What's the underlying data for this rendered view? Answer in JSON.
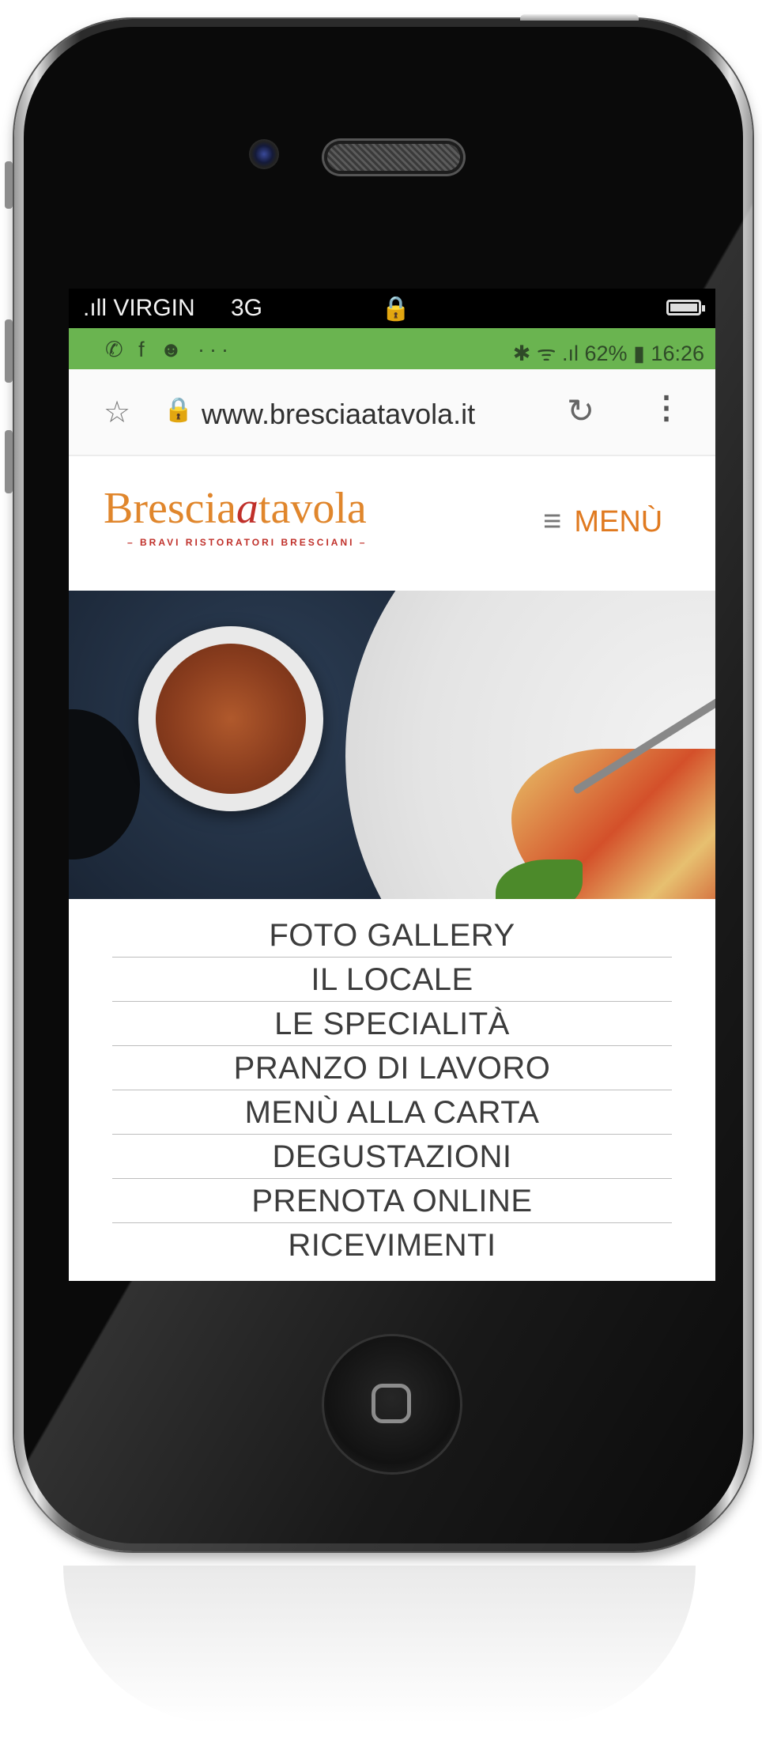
{
  "ios_status": {
    "carrier": ".ıll VIRGIN",
    "network": "3G",
    "lock_glyph": "🔒",
    "battery_icon": "battery-icon"
  },
  "android_status": {
    "left_icons": "✆ f ☻ ···",
    "right_text": "✱ ᯤ .ıl 62% ▮ 16:26"
  },
  "browser": {
    "url": "www.bresciaatavola.it",
    "star_icon": "☆",
    "lock_icon": "🔒",
    "reload_icon": "↻",
    "menu_icon": "⋮"
  },
  "site": {
    "logo_part1": "Brescia",
    "logo_part2": "a",
    "logo_part3": "tavola",
    "logo_tagline": "– BRAVI RISTORATORI BRESCIANI –",
    "menu_icon": "≡",
    "menu_label": "MENÙ",
    "accent_color": "#e07a20",
    "logo_red": "#c0302a"
  },
  "nav": {
    "items": [
      "FOTO GALLERY",
      "IL LOCALE",
      "LE SPECIALITÀ",
      "PRANZO DI LAVORO",
      "MENÙ ALLA CARTA",
      "DEGUSTAZIONI",
      "PRENOTA ONLINE",
      "RICEVIMENTI"
    ]
  }
}
